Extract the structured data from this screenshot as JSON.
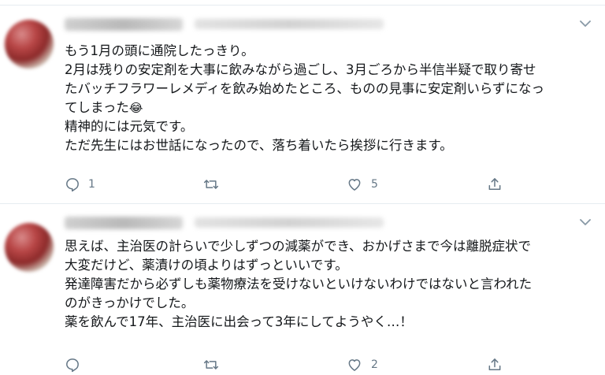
{
  "tweets": [
    {
      "lines": [
        "もう1月の頭に通院したっきり。",
        "2月は残りの安定剤を大事に飲みながら過ごし、3月ごろから半信半疑で取り寄せ",
        "たバッチフラワーレメディを飲み始めたところ、ものの見事に安定剤いらずになっ",
        "てしまった",
        "精神的には元気です。",
        "ただ先生にはお世話になったので、落ち着いたら挨拶に行きます。"
      ],
      "emoji": "😂",
      "reply_count": "1",
      "retweet_count": "",
      "like_count": "5"
    },
    {
      "lines": [
        "思えば、主治医の計らいで少しずつの減薬ができ、おかげさまで今は離脱症状で",
        "大変だけど、薬漬けの頃よりはずっといいです。",
        "発達障害だから必ずしも薬物療法を受けないといけないわけではないと言われた",
        "のがきっかけでした。",
        "薬を飲んで17年、主治医に出会って3年にしてようやく…！"
      ],
      "reply_count": "",
      "retweet_count": "",
      "like_count": "2"
    }
  ],
  "colors": {
    "text": "#14171a",
    "secondary": "#657786",
    "divider": "#e6ecf0"
  },
  "icons": {
    "reply": "reply-icon",
    "retweet": "retweet-icon",
    "like": "heart-icon",
    "share": "share-icon",
    "menu": "chevron-down-icon"
  }
}
